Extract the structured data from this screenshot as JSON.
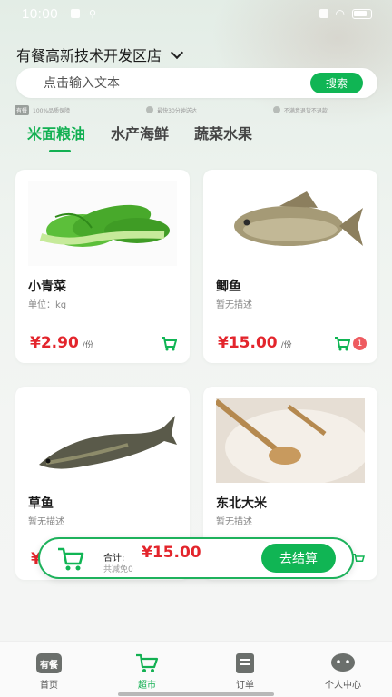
{
  "status_bar": {
    "time": "10:00"
  },
  "store": {
    "name": "有餐高新技术开发区店"
  },
  "search": {
    "placeholder": "点击输入文本",
    "button": "搜索"
  },
  "features": [
    {
      "badge": "有餐",
      "text": "100%品质保障"
    },
    {
      "text": "最快30分钟送达"
    },
    {
      "text": "不满意退货不退款"
    }
  ],
  "tabs": [
    {
      "label": "米面粮油",
      "active": true
    },
    {
      "label": "水产海鲜",
      "active": false
    },
    {
      "label": "蔬菜水果",
      "active": false
    }
  ],
  "products": [
    {
      "name": "小青菜",
      "desc": "单位：kg",
      "price": "¥2.90",
      "unit": "/份",
      "count": null
    },
    {
      "name": "鲫鱼",
      "desc": "暂无描述",
      "price": "¥15.00",
      "unit": "/份",
      "count": "1"
    },
    {
      "name": "草鱼",
      "desc": "暂无描述",
      "price": "¥",
      "unit": "",
      "count": null
    },
    {
      "name": "东北大米",
      "desc": "暂无描述",
      "price": "",
      "unit": "",
      "count": null
    }
  ],
  "checkout": {
    "total_label": "合计:",
    "total_value": "¥15.00",
    "saved": "共减免0",
    "pay_button": "去结算"
  },
  "tabbar": [
    {
      "label": "首页",
      "icon": "home-icon",
      "icon_text": "有餐",
      "active": false
    },
    {
      "label": "超市",
      "icon": "cart-icon",
      "active": true
    },
    {
      "label": "订单",
      "icon": "order-icon",
      "active": false
    },
    {
      "label": "个人中心",
      "icon": "profile-icon",
      "active": false
    }
  ],
  "colors": {
    "accent": "#10b554",
    "price": "#e3252c",
    "badge": "#ee5b60"
  }
}
